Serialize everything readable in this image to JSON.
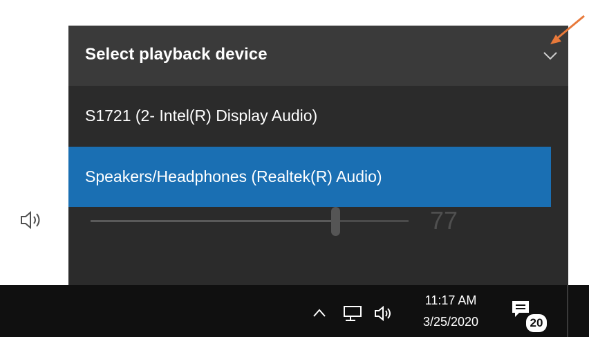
{
  "flyout": {
    "title": "Select playback device",
    "devices": [
      {
        "label": "S1721 (2- Intel(R) Display Audio)",
        "selected": false
      },
      {
        "label": "Speakers/Headphones (Realtek(R) Audio)",
        "selected": true
      }
    ],
    "volume": {
      "value": "77",
      "level": 0.77,
      "icon": "speaker-icon"
    },
    "expand_icon": "chevron-down-icon"
  },
  "taskbar": {
    "time": "11:17 AM",
    "date": "3/25/2020",
    "notification_count": "20",
    "tray_icons": [
      "chevron-up-icon",
      "network-icon",
      "volume-icon",
      "action-center-icon"
    ]
  },
  "colors": {
    "selected_device_bg": "#1a6fb3",
    "header_bg": "#3a3a3a",
    "panel_bg": "#2b2b2b",
    "taskbar_bg": "#101010",
    "annotation_arrow": "#e8793a"
  }
}
